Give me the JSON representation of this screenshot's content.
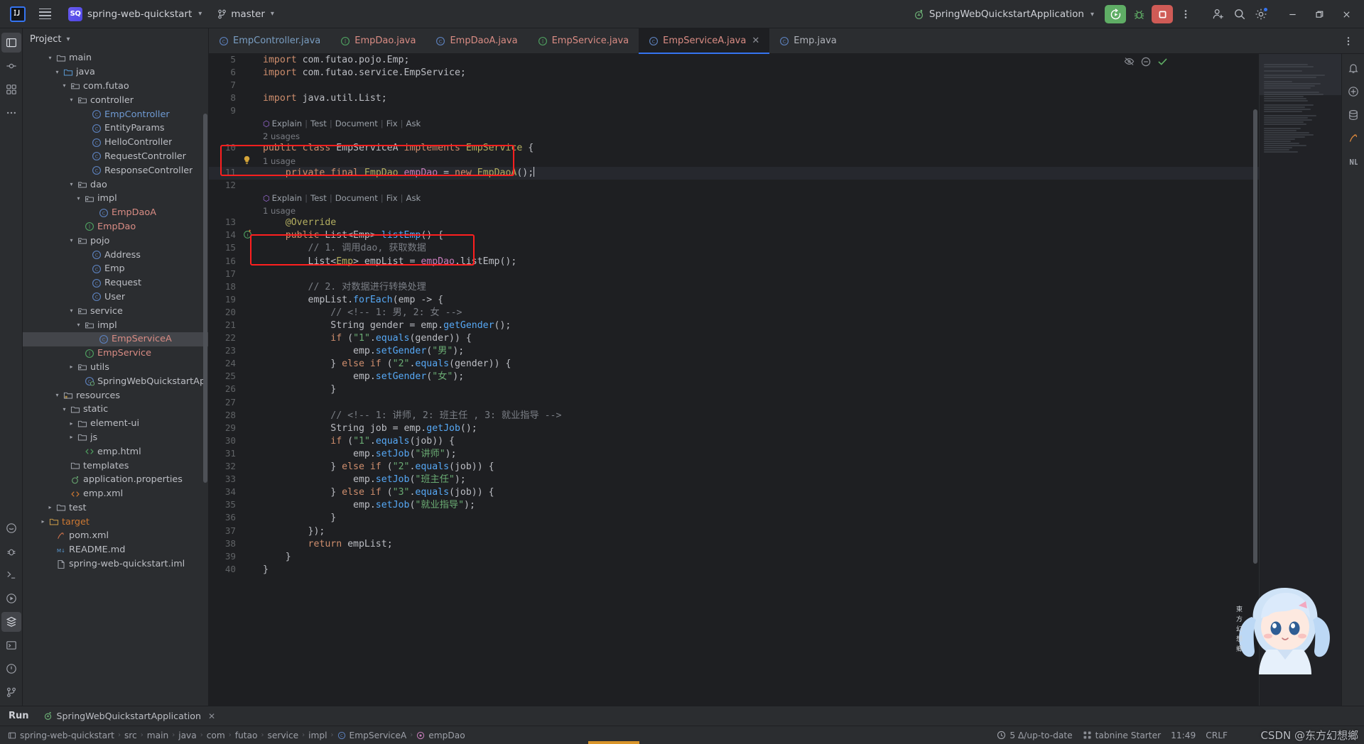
{
  "titlebar": {
    "logo_text": "IJ",
    "project_badge": "SQ",
    "project_name": "spring-web-quickstart",
    "branch_name": "master",
    "run_config": "SpringWebQuickstartApplication",
    "icons": {
      "menu": "hamburger-icon",
      "branch": "branch-icon",
      "run": "run-icon",
      "debug": "debug-icon",
      "stop": "stop-icon",
      "more": "more-vertical-icon",
      "share": "add-user-icon",
      "search": "search-icon",
      "settings": "settings-icon",
      "minimize": "minimize-icon",
      "maximize": "maximize-icon",
      "close": "close-icon"
    }
  },
  "sidebar": {
    "title": "Project",
    "tree": [
      {
        "indent": 3,
        "arrow": "down",
        "icon": "folder",
        "label": "main",
        "color": "norm"
      },
      {
        "indent": 4,
        "arrow": "down",
        "icon": "folder-src",
        "label": "java",
        "color": "norm"
      },
      {
        "indent": 5,
        "arrow": "down",
        "icon": "package",
        "label": "com.futao",
        "color": "norm"
      },
      {
        "indent": 6,
        "arrow": "down",
        "icon": "package",
        "label": "controller",
        "color": "norm"
      },
      {
        "indent": 8,
        "arrow": "none",
        "icon": "class",
        "label": "EmpController",
        "color": "blue"
      },
      {
        "indent": 8,
        "arrow": "none",
        "icon": "class",
        "label": "EntityParams",
        "color": "norm"
      },
      {
        "indent": 8,
        "arrow": "none",
        "icon": "class",
        "label": "HelloController",
        "color": "norm"
      },
      {
        "indent": 8,
        "arrow": "none",
        "icon": "class",
        "label": "RequestController",
        "color": "norm"
      },
      {
        "indent": 8,
        "arrow": "none",
        "icon": "class",
        "label": "ResponseController",
        "color": "norm"
      },
      {
        "indent": 6,
        "arrow": "down",
        "icon": "package",
        "label": "dao",
        "color": "norm"
      },
      {
        "indent": 7,
        "arrow": "down",
        "icon": "package",
        "label": "impl",
        "color": "norm"
      },
      {
        "indent": 9,
        "arrow": "none",
        "icon": "class",
        "label": "EmpDaoA",
        "color": "red"
      },
      {
        "indent": 7,
        "arrow": "none",
        "icon": "interface",
        "label": "EmpDao",
        "color": "red"
      },
      {
        "indent": 6,
        "arrow": "down",
        "icon": "package",
        "label": "pojo",
        "color": "norm"
      },
      {
        "indent": 8,
        "arrow": "none",
        "icon": "class",
        "label": "Address",
        "color": "norm"
      },
      {
        "indent": 8,
        "arrow": "none",
        "icon": "class",
        "label": "Emp",
        "color": "norm"
      },
      {
        "indent": 8,
        "arrow": "none",
        "icon": "class",
        "label": "Request",
        "color": "norm"
      },
      {
        "indent": 8,
        "arrow": "none",
        "icon": "class",
        "label": "User",
        "color": "norm"
      },
      {
        "indent": 6,
        "arrow": "down",
        "icon": "package",
        "label": "service",
        "color": "norm"
      },
      {
        "indent": 7,
        "arrow": "down",
        "icon": "package",
        "label": "impl",
        "color": "norm"
      },
      {
        "indent": 9,
        "arrow": "none",
        "icon": "class",
        "label": "EmpServiceA",
        "color": "red",
        "selected": true
      },
      {
        "indent": 7,
        "arrow": "none",
        "icon": "interface",
        "label": "EmpService",
        "color": "red"
      },
      {
        "indent": 6,
        "arrow": "right",
        "icon": "package",
        "label": "utils",
        "color": "norm"
      },
      {
        "indent": 7,
        "arrow": "none",
        "icon": "spring",
        "label": "SpringWebQuickstartAppli",
        "color": "norm"
      },
      {
        "indent": 4,
        "arrow": "down",
        "icon": "resources",
        "label": "resources",
        "color": "norm"
      },
      {
        "indent": 5,
        "arrow": "down",
        "icon": "folder",
        "label": "static",
        "color": "norm"
      },
      {
        "indent": 6,
        "arrow": "right",
        "icon": "folder",
        "label": "element-ui",
        "color": "norm"
      },
      {
        "indent": 6,
        "arrow": "right",
        "icon": "folder",
        "label": "js",
        "color": "norm"
      },
      {
        "indent": 7,
        "arrow": "none",
        "icon": "html",
        "label": "emp.html",
        "color": "norm"
      },
      {
        "indent": 5,
        "arrow": "none",
        "icon": "folder",
        "label": "templates",
        "color": "norm"
      },
      {
        "indent": 5,
        "arrow": "none",
        "icon": "spring-prop",
        "label": "application.properties",
        "color": "norm"
      },
      {
        "indent": 5,
        "arrow": "none",
        "icon": "xml",
        "label": "emp.xml",
        "color": "norm"
      },
      {
        "indent": 3,
        "arrow": "right",
        "icon": "folder",
        "label": "test",
        "color": "norm"
      },
      {
        "indent": 2,
        "arrow": "right",
        "icon": "folder-tgt",
        "label": "target",
        "color": "orange"
      },
      {
        "indent": 3,
        "arrow": "none",
        "icon": "maven",
        "label": "pom.xml",
        "color": "norm"
      },
      {
        "indent": 3,
        "arrow": "none",
        "icon": "md",
        "label": "README.md",
        "color": "norm"
      },
      {
        "indent": 3,
        "arrow": "none",
        "icon": "iml",
        "label": "spring-web-quickstart.iml",
        "color": "norm"
      }
    ]
  },
  "tabs": [
    {
      "label": "EmpController.java",
      "icon": "class",
      "color": "blue",
      "active": false
    },
    {
      "label": "EmpDao.java",
      "icon": "interface",
      "color": "red",
      "active": false
    },
    {
      "label": "EmpDaoA.java",
      "icon": "class",
      "color": "red",
      "active": false
    },
    {
      "label": "EmpService.java",
      "icon": "interface",
      "color": "red",
      "active": false
    },
    {
      "label": "EmpServiceA.java",
      "icon": "class",
      "color": "red",
      "active": true
    },
    {
      "label": "Emp.java",
      "icon": "class",
      "color": "norm",
      "active": false
    }
  ],
  "ai_hint": {
    "icon": "ai-assistant-icon",
    "items": [
      "Explain",
      "Test",
      "Document",
      "Fix",
      "Ask"
    ],
    "separator": "|"
  },
  "usages": {
    "two": "2 usages",
    "one": "1 usage"
  },
  "code": {
    "lines": [
      {
        "n": "5",
        "html": "<span class=\"kw\">import</span> com.futao.pojo.Emp;"
      },
      {
        "n": "6",
        "html": "<span class=\"kw\">import</span> com.futao.service.EmpService;"
      },
      {
        "n": "7",
        "html": ""
      },
      {
        "n": "8",
        "html": "<span class=\"kw\">import</span> java.util.List;"
      },
      {
        "n": "9",
        "html": ""
      },
      {
        "n": "10",
        "html": "<span class=\"kw\">public class</span> EmpServiceA <span class=\"kw\">implements</span> <span class=\"ann\">EmpService</span> {"
      },
      {
        "n": "11",
        "html": "    <span class=\"kw\">private final</span> <span class=\"ann\">EmpDao</span> <span class=\"fld\">empDao</span> = <span class=\"kw\">new</span> <span class=\"ann\">EmpDaoA</span>();<span class=\"caretmark\"></span>"
      },
      {
        "n": "12",
        "html": ""
      },
      {
        "n": "13",
        "html": "    <span class=\"ann\">@Override</span>"
      },
      {
        "n": "14",
        "html": "    <span class=\"kw\">public</span> List&lt;Emp&gt; <span class=\"mth\">listEmp</span>() {",
        "gutter": "override"
      },
      {
        "n": "15",
        "html": "        <span class=\"cmt\">// 1. 调用dao, 获取数据</span>"
      },
      {
        "n": "16",
        "html": "        List&lt;<span class=\"ann\">Emp</span>&gt; empList = <span class=\"fld\">empDao</span>.listEmp();"
      },
      {
        "n": "17",
        "html": ""
      },
      {
        "n": "18",
        "html": "        <span class=\"cmt\">// 2. 对数据进行转换处理</span>"
      },
      {
        "n": "19",
        "html": "        empList.<span class=\"mth\">forEach</span>(emp -&gt; {"
      },
      {
        "n": "20",
        "html": "            <span class=\"cmt\">// &lt;!-- 1: 男, 2: 女 --&gt;</span>"
      },
      {
        "n": "21",
        "html": "            String gender = emp.<span class=\"mth\">getGender</span>();"
      },
      {
        "n": "22",
        "html": "            <span class=\"kw\">if</span> (<span class=\"str\">\"1\"</span>.<span class=\"mth\">equals</span>(gender)) {"
      },
      {
        "n": "23",
        "html": "                emp.<span class=\"mth\">setGender</span>(<span class=\"str\">\"男\"</span>);"
      },
      {
        "n": "24",
        "html": "            } <span class=\"kw\">else if</span> (<span class=\"str\">\"2\"</span>.<span class=\"mth\">equals</span>(gender)) {"
      },
      {
        "n": "25",
        "html": "                emp.<span class=\"mth\">setGender</span>(<span class=\"str\">\"女\"</span>);"
      },
      {
        "n": "26",
        "html": "            }"
      },
      {
        "n": "27",
        "html": ""
      },
      {
        "n": "28",
        "html": "            <span class=\"cmt\">// &lt;!-- 1: 讲师, 2: 班主任 , 3: 就业指导 --&gt;</span>"
      },
      {
        "n": "29",
        "html": "            String job = emp.<span class=\"mth\">getJob</span>();"
      },
      {
        "n": "30",
        "html": "            <span class=\"kw\">if</span> (<span class=\"str\">\"1\"</span>.<span class=\"mth\">equals</span>(job)) {"
      },
      {
        "n": "31",
        "html": "                emp.<span class=\"mth\">setJob</span>(<span class=\"str\">\"讲师\"</span>);"
      },
      {
        "n": "32",
        "html": "            } <span class=\"kw\">else if</span> (<span class=\"str\">\"2\"</span>.<span class=\"mth\">equals</span>(job)) {"
      },
      {
        "n": "33",
        "html": "                emp.<span class=\"mth\">setJob</span>(<span class=\"str\">\"班主任\"</span>);"
      },
      {
        "n": "34",
        "html": "            } <span class=\"kw\">else if</span> (<span class=\"str\">\"3\"</span>.<span class=\"mth\">equals</span>(job)) {"
      },
      {
        "n": "35",
        "html": "                emp.<span class=\"mth\">setJob</span>(<span class=\"str\">\"就业指导\"</span>);"
      },
      {
        "n": "36",
        "html": "            }"
      },
      {
        "n": "37",
        "html": "        });"
      },
      {
        "n": "38",
        "html": "        <span class=\"kw\">return</span> empList;"
      },
      {
        "n": "39",
        "html": "    }"
      },
      {
        "n": "40",
        "html": "}"
      }
    ]
  },
  "runbar": {
    "label": "Run",
    "tab_label": "SpringWebQuickstartApplication",
    "tab_icon": "spring-run-icon",
    "close_icon": "close-icon"
  },
  "statusbar": {
    "breadcrumbs": [
      {
        "label": "spring-web-quickstart",
        "icon": "module-icon"
      },
      {
        "label": "src",
        "icon": ""
      },
      {
        "label": "main",
        "icon": ""
      },
      {
        "label": "java",
        "icon": ""
      },
      {
        "label": "com",
        "icon": ""
      },
      {
        "label": "futao",
        "icon": ""
      },
      {
        "label": "service",
        "icon": ""
      },
      {
        "label": "impl",
        "icon": ""
      },
      {
        "label": "EmpServiceA",
        "icon": "class-icon"
      },
      {
        "label": "empDao",
        "icon": "field-icon"
      }
    ],
    "right": {
      "vcs_status": "5 Δ/up-to-date",
      "tabnine": "tabnine Starter",
      "position": "11:49",
      "line_sep": "CRLF"
    }
  },
  "watermark": "CSDN @东方幻想鄉",
  "colors": {
    "accent_blue": "#3574f0",
    "run_green": "#5fad65",
    "stop_red": "#cf5b56",
    "annotation_red": "#ff1f1f",
    "bg_editor": "#1e1f22",
    "bg_panel": "#2b2d30",
    "string_green": "#6aab73",
    "keyword_orange": "#cf8e6d",
    "comment_gray": "#7a7e85"
  }
}
